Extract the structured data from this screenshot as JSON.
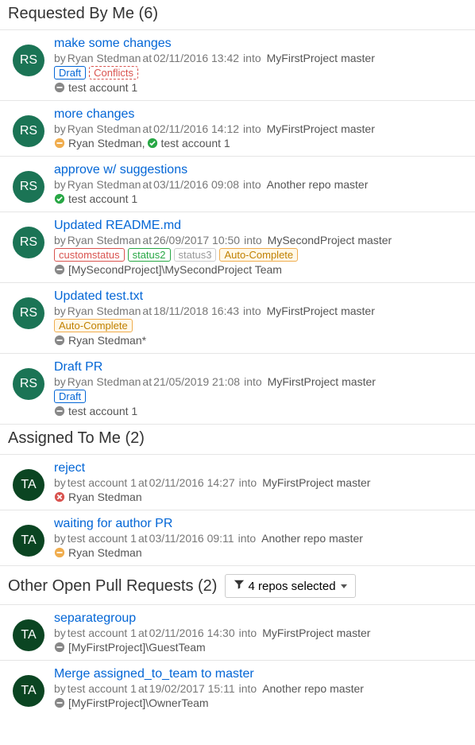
{
  "sections": {
    "requested": {
      "title": "Requested By Me (6)"
    },
    "assigned": {
      "title": "Assigned To Me (2)"
    },
    "other": {
      "title": "Other Open Pull Requests (2)",
      "filter": "4 repos selected"
    }
  },
  "prs": {
    "requested": [
      {
        "avatar": "RS",
        "title": "make some changes",
        "author": "Ryan Stedman",
        "date": "02/11/2016 13:42",
        "repo": "MyFirstProject",
        "branch": "master",
        "tags": [
          {
            "text": "Draft",
            "cls": "blue"
          },
          {
            "text": "Conflicts",
            "cls": "red-dashed"
          }
        ],
        "reviewers": [
          {
            "status": "novote",
            "name": "test account 1"
          }
        ]
      },
      {
        "avatar": "RS",
        "title": "more changes",
        "author": "Ryan Stedman",
        "date": "02/11/2016 14:12",
        "repo": "MyFirstProject",
        "branch": "master",
        "tags": [],
        "reviewers": [
          {
            "status": "waiting",
            "name": "Ryan Stedman,"
          },
          {
            "status": "approved",
            "name": "test account 1"
          }
        ]
      },
      {
        "avatar": "RS",
        "title": "approve w/ suggestions",
        "author": "Ryan Stedman",
        "date": "03/11/2016 09:08",
        "repo": "Another repo",
        "branch": "master",
        "tags": [],
        "reviewers": [
          {
            "status": "approved",
            "name": "test account 1"
          }
        ]
      },
      {
        "avatar": "RS",
        "title": "Updated README.md",
        "author": "Ryan Stedman",
        "date": "26/09/2017 10:50",
        "repo": "MySecondProject",
        "branch": "master",
        "tags": [
          {
            "text": "customstatus",
            "cls": "red"
          },
          {
            "text": "status2",
            "cls": "green"
          },
          {
            "text": "status3",
            "cls": "gray"
          },
          {
            "text": "Auto-Complete",
            "cls": "orange"
          }
        ],
        "reviewers": [
          {
            "status": "novote",
            "name": "[MySecondProject]\\MySecondProject Team"
          }
        ]
      },
      {
        "avatar": "RS",
        "title": "Updated test.txt",
        "author": "Ryan Stedman",
        "date": "18/11/2018 16:43",
        "repo": "MyFirstProject",
        "branch": "master",
        "tags": [
          {
            "text": "Auto-Complete",
            "cls": "orange"
          }
        ],
        "reviewers": [
          {
            "status": "novote",
            "name": "Ryan Stedman*"
          }
        ]
      },
      {
        "avatar": "RS",
        "title": "Draft PR",
        "author": "Ryan Stedman",
        "date": "21/05/2019 21:08",
        "repo": "MyFirstProject",
        "branch": "master",
        "tags": [
          {
            "text": "Draft",
            "cls": "blue"
          }
        ],
        "reviewers": [
          {
            "status": "novote",
            "name": "test account 1"
          }
        ]
      }
    ],
    "assigned": [
      {
        "avatar": "TA",
        "title": "reject",
        "author": "test account 1",
        "date": "02/11/2016 14:27",
        "repo": "MyFirstProject",
        "branch": "master",
        "tags": [],
        "reviewers": [
          {
            "status": "rejected",
            "name": "Ryan Stedman"
          }
        ]
      },
      {
        "avatar": "TA",
        "title": "waiting for author PR",
        "author": "test account 1",
        "date": "03/11/2016 09:11",
        "repo": "Another repo",
        "branch": "master",
        "tags": [],
        "reviewers": [
          {
            "status": "waiting",
            "name": "Ryan Stedman"
          }
        ]
      }
    ],
    "other": [
      {
        "avatar": "TA",
        "title": "separategroup",
        "author": "test account 1",
        "date": "02/11/2016 14:30",
        "repo": "MyFirstProject",
        "branch": "master",
        "tags": [],
        "reviewers": [
          {
            "status": "novote",
            "name": "[MyFirstProject]\\GuestTeam"
          }
        ]
      },
      {
        "avatar": "TA",
        "title": "Merge assigned_to_team to master",
        "author": "test account 1",
        "date": "19/02/2017 15:11",
        "repo": "Another repo",
        "branch": "master",
        "tags": [],
        "reviewers": [
          {
            "status": "novote",
            "name": "[MyFirstProject]\\OwnerTeam"
          }
        ]
      }
    ]
  },
  "strings": {
    "by": "by",
    "at": "at",
    "into": "into"
  }
}
